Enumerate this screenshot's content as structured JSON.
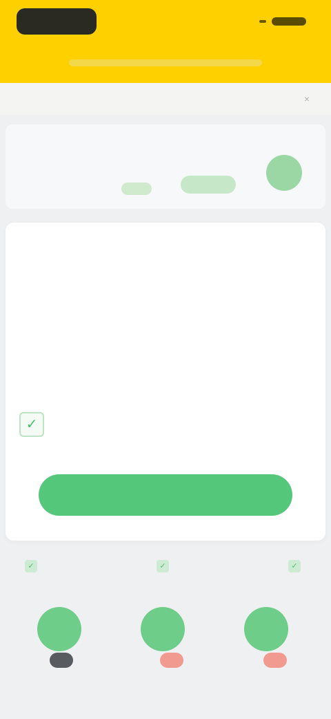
{
  "header": {
    "logo_label": "",
    "action_label": ""
  },
  "notice": {
    "text": "",
    "close_glyph": "×"
  },
  "price_card": {
    "old_price": "",
    "price": "",
    "discount_tag": "",
    "rating_label": "",
    "rating_value": "",
    "score": ""
  },
  "info_card": {
    "title": "",
    "meta": "",
    "subtitle": "",
    "features": [
      "",
      "",
      "",
      "",
      ""
    ],
    "note_label": "",
    "note_text": "",
    "check_title": "",
    "check_desc": "",
    "check_glyph": "✓",
    "cta_label": ""
  },
  "tabs": [
    {
      "icon": "check-icon",
      "glyph": "✓",
      "label": ""
    },
    {
      "icon": "check-icon",
      "glyph": "✓",
      "label": ""
    },
    {
      "icon": "check-icon",
      "glyph": "✓",
      "label": ""
    }
  ],
  "apps": [
    {
      "circle_label": "",
      "badge": "",
      "label": ""
    },
    {
      "circle_label": "",
      "badge": "",
      "label": ""
    },
    {
      "circle_label": "",
      "badge": "",
      "label": ""
    }
  ],
  "colors": {
    "brand_yellow": "#fed000",
    "accent_green": "#55c77a",
    "alert_red": "#f19a90"
  }
}
